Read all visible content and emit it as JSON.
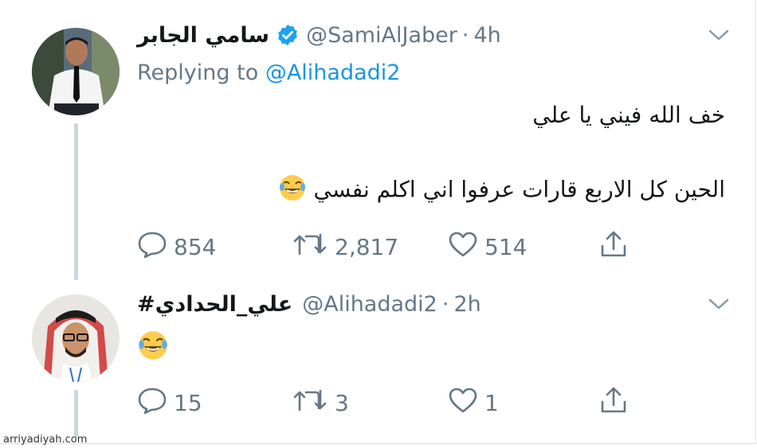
{
  "tweets": [
    {
      "name": "سامي الجابر",
      "verified": true,
      "handle": "@SamiAlJaber",
      "separator": "·",
      "time": "4h",
      "replying_prefix": "Replying to ",
      "replying_to": "@Alihadadi2",
      "lines": [
        "خف الله فيني يا علي",
        "الحين كل الاربع قارات عرفوا اني اكلم نفسي"
      ],
      "reply_count": "854",
      "retweet_count": "2,817",
      "like_count": "514"
    },
    {
      "name": "#علي_الحدادي",
      "verified": false,
      "handle": "@Alihadadi2",
      "separator": "·",
      "time": "2h",
      "emoji": "face-with-tears-of-joy",
      "reply_count": "15",
      "retweet_count": "3",
      "like_count": "1"
    }
  ],
  "colors": {
    "text": "#14171a",
    "secondary": "#657786",
    "link": "#1b95e0",
    "verified": "#1da1f2",
    "thread_line": "#ccd6dd"
  },
  "icons": [
    "reply-icon",
    "retweet-icon",
    "like-icon",
    "share-icon",
    "chevron-down-icon",
    "verified-badge-icon"
  ],
  "watermark": "arriyadiyah.com"
}
